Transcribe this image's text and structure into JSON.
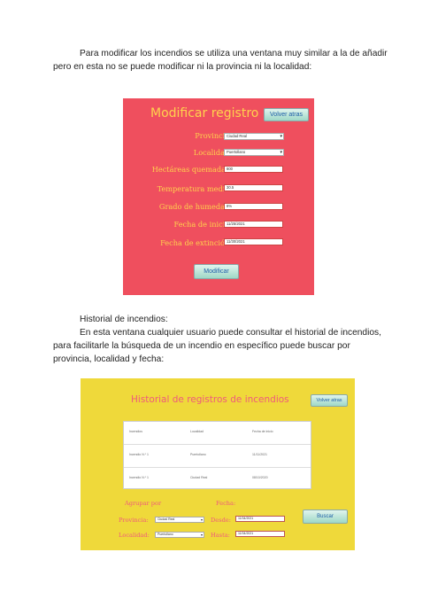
{
  "paragraph1": "Para modificar los incendios se utiliza una ventana muy similar a la de añadir pero en esta no se puede modificar ni la provincia ni la localidad:",
  "modify_window": {
    "title": "Modificar registro",
    "back_button": "Volver atras",
    "submit_button": "Modificar",
    "fields": {
      "provincia": {
        "label": "Provincia:",
        "value": "Ciudad Real"
      },
      "localidad": {
        "label": "Localidad:",
        "value": "Puertollano"
      },
      "hectareas": {
        "label": "Hectáreas quemadas:",
        "value": "800"
      },
      "temperatura": {
        "label": "Temperatura media:",
        "value": "30.5"
      },
      "humedad": {
        "label": "Grado de humedad:",
        "value": "8%"
      },
      "inicio": {
        "label": "Fecha de inicio:",
        "value": "11/25/2021"
      },
      "extincion": {
        "label": "Fecha de extinción:",
        "value": "11/30/2021"
      }
    }
  },
  "section_heading": "Historial de incendios:",
  "paragraph2": "En esta ventana cualquier usuario puede consultar el historial de incendios, para facilitarle la búsqueda de un incendio en específico puede buscar por provincia, localidad y fecha:",
  "history_window": {
    "title": "Historial de registros de incendios",
    "back_button": "Volver atras",
    "search_button": "Buscar",
    "table": {
      "headers": [
        "Incendios",
        "Localidad",
        "Fecha de inicio"
      ],
      "rows": [
        [
          "Incendio N.º 1",
          "Puertollano",
          "11/11/2021"
        ],
        [
          "Incendio N.º 1",
          "Ciudad Real",
          "08/10/2020"
        ]
      ]
    },
    "group_by_label": "Agrupar por",
    "date_label": "Fecha:",
    "provincia_label": "Provincia:",
    "provincia_value": "Ciudad Real",
    "localidad_label": "Localidad:",
    "localidad_value": "Puertollano",
    "desde_label": "Desde:",
    "desde_value": "11/04/2021",
    "hasta_label": "Hasta:",
    "hasta_value": "11/04/2021"
  }
}
